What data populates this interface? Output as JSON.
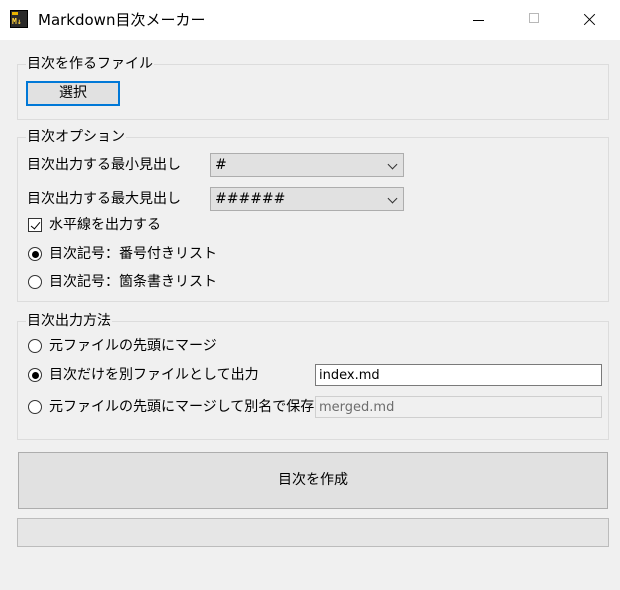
{
  "window": {
    "title": "Markdown目次メーカー",
    "icon_text": "M↓"
  },
  "file_group": {
    "legend": "目次を作るファイル",
    "select_button": "選択"
  },
  "options_group": {
    "legend": "目次オプション",
    "min_heading_label": "目次出力する最小見出し",
    "min_heading_value": "#",
    "max_heading_label": "目次出力する最大見出し",
    "max_heading_value": "######",
    "hr_checkbox_label": "水平線を出力する",
    "hr_checked": true,
    "numbered_list_label": "目次記号：番号付きリスト",
    "bullet_list_label": "目次記号：箇条書きリスト",
    "list_style_selected": "numbered"
  },
  "output_group": {
    "legend": "目次出力方法",
    "merge_label": "元ファイルの先頭にマージ",
    "separate_label": "目次だけを別ファイルとして出力",
    "separate_filename": "index.md",
    "merge_rename_label": "元ファイルの先頭にマージして別名で保存",
    "merged_filename": "merged.md",
    "selected": "separate"
  },
  "create_button": "目次を作成",
  "progress": 0,
  "colors": {
    "accent": "#0078d7",
    "window_bg": "#f0f0f0",
    "progress_fill": "#06b025"
  }
}
